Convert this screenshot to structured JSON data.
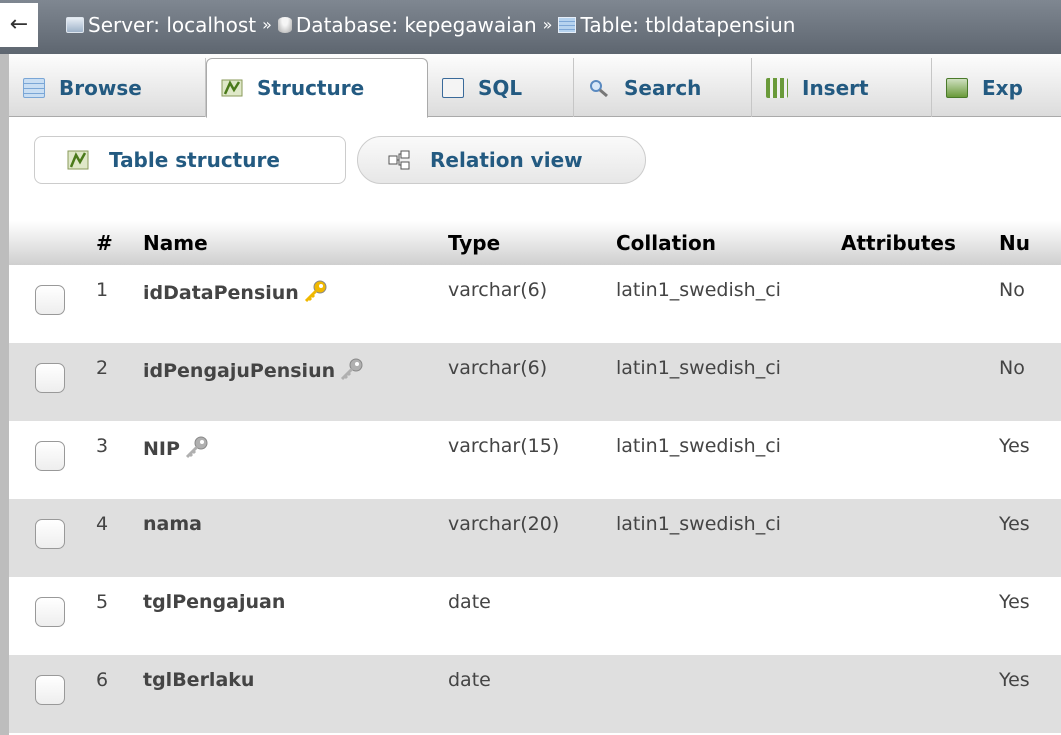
{
  "breadcrumb": {
    "collapse_glyph": "←",
    "server": "Server: localhost",
    "separator": "»",
    "database": "Database: kepegawaian",
    "table": "Table: tbldatapensiun"
  },
  "tabs": [
    {
      "label": "Browse",
      "icon": "browse-icon",
      "active": false
    },
    {
      "label": "Structure",
      "icon": "structure-icon",
      "active": true
    },
    {
      "label": "SQL",
      "icon": "sql-icon",
      "active": false
    },
    {
      "label": "Search",
      "icon": "search-icon",
      "active": false
    },
    {
      "label": "Insert",
      "icon": "insert-icon",
      "active": false
    },
    {
      "label": "Exp",
      "icon": "export-icon",
      "active": false
    }
  ],
  "subtabs": {
    "table_structure": "Table structure",
    "relation_view": "Relation view"
  },
  "table": {
    "headers": [
      "#",
      "Name",
      "Type",
      "Collation",
      "Attributes",
      "Nu"
    ],
    "rows": [
      {
        "num": "1",
        "name": "idDataPensiun",
        "key": "primary",
        "type": "varchar(6)",
        "collation": "latin1_swedish_ci",
        "attributes": "",
        "null": "No"
      },
      {
        "num": "2",
        "name": "idPengajuPensiun",
        "key": "index",
        "type": "varchar(6)",
        "collation": "latin1_swedish_ci",
        "attributes": "",
        "null": "No"
      },
      {
        "num": "3",
        "name": "NIP",
        "key": "index",
        "type": "varchar(15)",
        "collation": "latin1_swedish_ci",
        "attributes": "",
        "null": "Yes"
      },
      {
        "num": "4",
        "name": "nama",
        "key": "",
        "type": "varchar(20)",
        "collation": "latin1_swedish_ci",
        "attributes": "",
        "null": "Yes"
      },
      {
        "num": "5",
        "name": "tglPengajuan",
        "key": "",
        "type": "date",
        "collation": "",
        "attributes": "",
        "null": "Yes"
      },
      {
        "num": "6",
        "name": "tglBerlaku",
        "key": "",
        "type": "date",
        "collation": "",
        "attributes": "",
        "null": "Yes"
      }
    ]
  },
  "colors": {
    "link": "#235a81",
    "primary_key": "#f0b800",
    "index_key": "#b0b0b0",
    "even_row": "#dfdfdf"
  }
}
